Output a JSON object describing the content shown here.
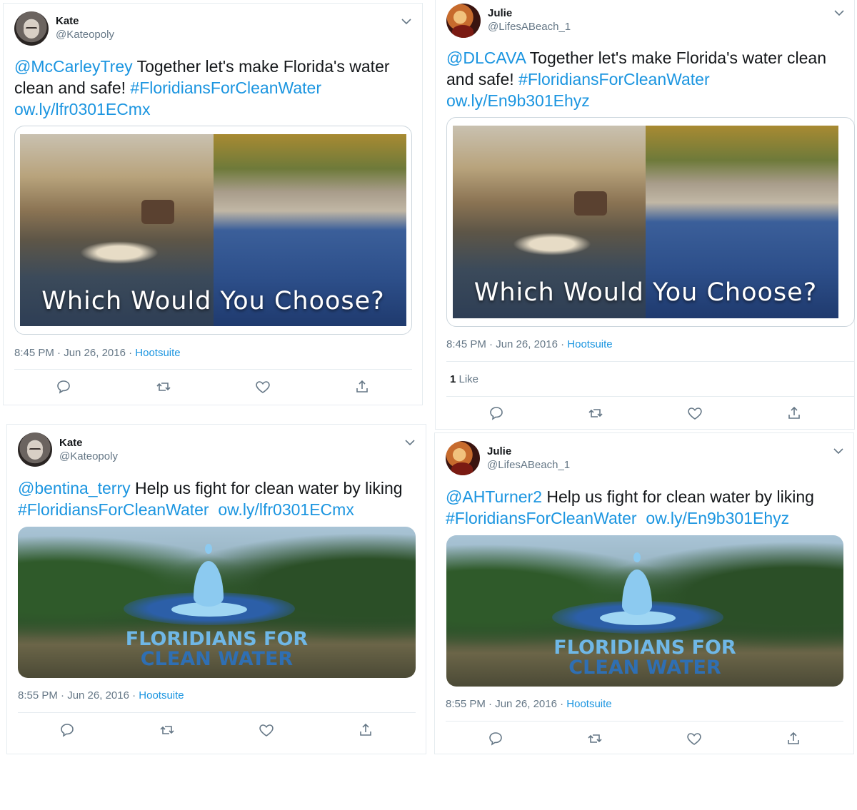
{
  "tweets": [
    {
      "name": "Kate",
      "handle": "@Kateopoly",
      "mention": "@McCarleyTrey",
      "text1": " Together let's make Florida's water",
      "text2": "clean and safe! ",
      "hashtag": "#FloridiansForCleanWater",
      "url": "ow.ly/lfr0301ECmx",
      "image_caption": "Which Would You Choose?",
      "time": "8:45 PM · Jun 26, 2016 · ",
      "source": "Hootsuite"
    },
    {
      "name": "Julie",
      "handle": "@LifesABeach_1",
      "mention": "@DLCAVA",
      "text1": " Together let's make Florida's water clean",
      "text2": "and safe! ",
      "hashtag": "#FloridiansForCleanWater",
      "url": "ow.ly/En9b301Ehyz",
      "image_caption": "Which Would You Choose?",
      "time": "8:45 PM · Jun 26, 2016 · ",
      "source": "Hootsuite",
      "like_count": "1",
      "like_label": " Like"
    },
    {
      "name": "Kate",
      "handle": "@Kateopoly",
      "mention": "@bentina_terry",
      "text1": " Help us fight for clean water by liking",
      "hashtag": "#FloridiansForCleanWater",
      "url": "ow.ly/lfr0301ECmx",
      "image_line1": "FLORIDIANS FOR",
      "image_line2": "CLEAN WATER",
      "time": "8:55 PM · Jun 26, 2016 · ",
      "source": "Hootsuite"
    },
    {
      "name": "Julie",
      "handle": "@LifesABeach_1",
      "mention": "@AHTurner2",
      "text1": " Help us fight for clean water by liking",
      "hashtag": "#FloridiansForCleanWater",
      "url": "ow.ly/En9b301Ehyz",
      "image_line1": "FLORIDIANS FOR",
      "image_line2": "CLEAN WATER",
      "time": "8:55 PM · Jun 26, 2016 · ",
      "source": "Hootsuite"
    }
  ],
  "colors": {
    "link": "#1b95e0",
    "text": "#14171a",
    "muted": "#657786",
    "border": "#e6ecf0"
  },
  "icons": [
    "chevron-down-icon",
    "reply-icon",
    "retweet-icon",
    "like-icon",
    "share-icon"
  ]
}
